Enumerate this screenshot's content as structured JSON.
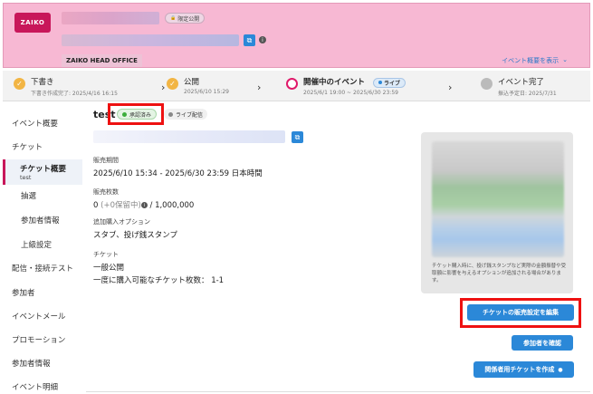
{
  "header": {
    "logo_text": "ZAIKO",
    "visibility_badge": "限定公開",
    "org_name": "ZAIKO HEAD OFFICE",
    "summary_link": "イベント概要を表示",
    "chevron": "⌄",
    "copy_glyph": "⧉",
    "info_glyph": "i",
    "lock_glyph": "🔒"
  },
  "progress": {
    "steps": [
      {
        "title": "下書き",
        "sub": "下書き作成完了: 2025/4/16 16:15",
        "icon": "check-icon",
        "color": "#f2b544"
      },
      {
        "title": "公開",
        "sub": "2025/6/10 15:29",
        "icon": "check-icon",
        "color": "#f2b544"
      },
      {
        "title": "開催中のイベント",
        "sub": "2025/6/1 19:00 ~ 2025/6/30 23:59",
        "badge": "ライブ",
        "icon": "ring-icon",
        "color": "#e0196a"
      },
      {
        "title": "イベント完了",
        "sub": "振込予定日: 2025/7/31",
        "icon": "circle-icon",
        "color": "#bbbbbb"
      }
    ],
    "arrow": "›"
  },
  "sidebar": {
    "items": [
      {
        "label": "イベント概要"
      },
      {
        "label": "チケット"
      },
      {
        "label": "チケット概要",
        "sub": "test"
      },
      {
        "label": "抽選"
      },
      {
        "label": "参加者情報"
      },
      {
        "label": "上級設定"
      },
      {
        "label": "配信・接続テスト"
      },
      {
        "label": "参加者"
      },
      {
        "label": "イベントメール"
      },
      {
        "label": "プロモーション"
      },
      {
        "label": "参加者情報"
      },
      {
        "label": "イベント明細"
      }
    ]
  },
  "main": {
    "ticket_name": "test",
    "status_badge": "承認済み",
    "stream_badge": "ライブ配信",
    "sales_period_label": "販売期間",
    "sales_period_value": "2025/6/10 15:34 - 2025/6/30 23:59 日本時間",
    "sales_count_label": "販売枚数",
    "sales_count_prefix": "0",
    "sales_count_hold": "(+0保留中)",
    "sales_count_suffix": "/ 1,000,000",
    "options_label": "追加購入オプション",
    "options_value": "スタブ、投げ銭スタンプ",
    "ticket_label": "チケット",
    "ticket_type": "一般公開",
    "ticket_limit": "一度に購入可能なチケット枚数： 1-1",
    "preview_note": "チケット購入時に、投げ銭スタンプなど実際の金額振替や受取額に影響を与えるオプションが追加される場合があります。",
    "edit_button": "チケットの販売設定を編集",
    "confirm_button": "参加者を確認",
    "create_button": "関係者用チケットを作成",
    "create_glyph": "●"
  },
  "colors": {
    "brand": "#c8175a",
    "header_bg": "#f7b8d3",
    "button": "#2b88d8",
    "approved_dot": "#3cae3c",
    "highlight": "#ee1111"
  }
}
